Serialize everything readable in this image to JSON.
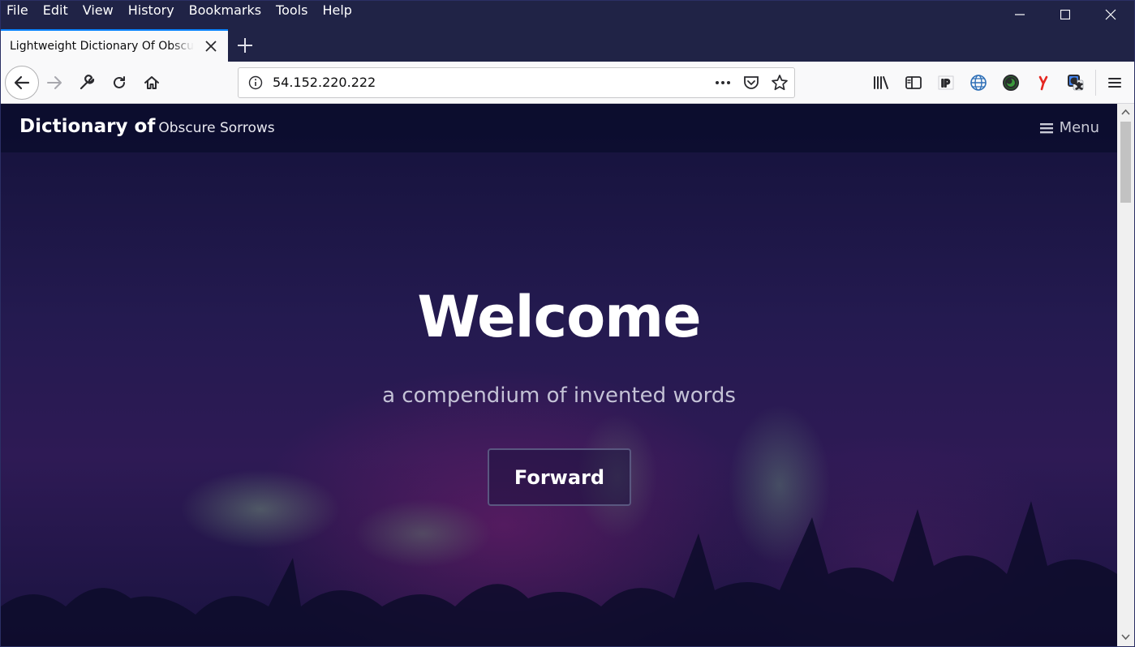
{
  "menubar": {
    "items": [
      {
        "label": "File"
      },
      {
        "label": "Edit"
      },
      {
        "label": "View"
      },
      {
        "label": "History"
      },
      {
        "label": "Bookmarks"
      },
      {
        "label": "Tools"
      },
      {
        "label": "Help"
      }
    ]
  },
  "tab": {
    "title": "Lightweight Dictionary Of Obscure Sorrows"
  },
  "navbar": {
    "url": "54.152.220.222"
  },
  "site": {
    "brand_strong": "Dictionary of",
    "brand_light": "Obscure Sorrows",
    "menu_label": "Menu"
  },
  "hero": {
    "title": "Welcome",
    "subtitle": "a compendium of invented words",
    "button_label": "Forward"
  },
  "icons": {
    "back": "arrow-left-icon",
    "forward": "arrow-right-icon",
    "tools": "wrench-icon",
    "reload": "reload-icon",
    "home": "home-icon",
    "info": "info-icon",
    "more": "ellipsis-icon",
    "pocket": "pocket-icon",
    "bookmark": "star-icon",
    "library": "library-icon",
    "sidebar": "sidebar-icon",
    "ip": "ip-icon",
    "globe": "globe-icon",
    "extension": "extension-icon",
    "yandex": "yandex-icon",
    "translate": "translate-icon",
    "hamburger": "hamburger-icon"
  },
  "colors": {
    "tab_accent": "#0a84ff",
    "chrome_dark": "#202346",
    "yandex_red": "#e52620"
  }
}
